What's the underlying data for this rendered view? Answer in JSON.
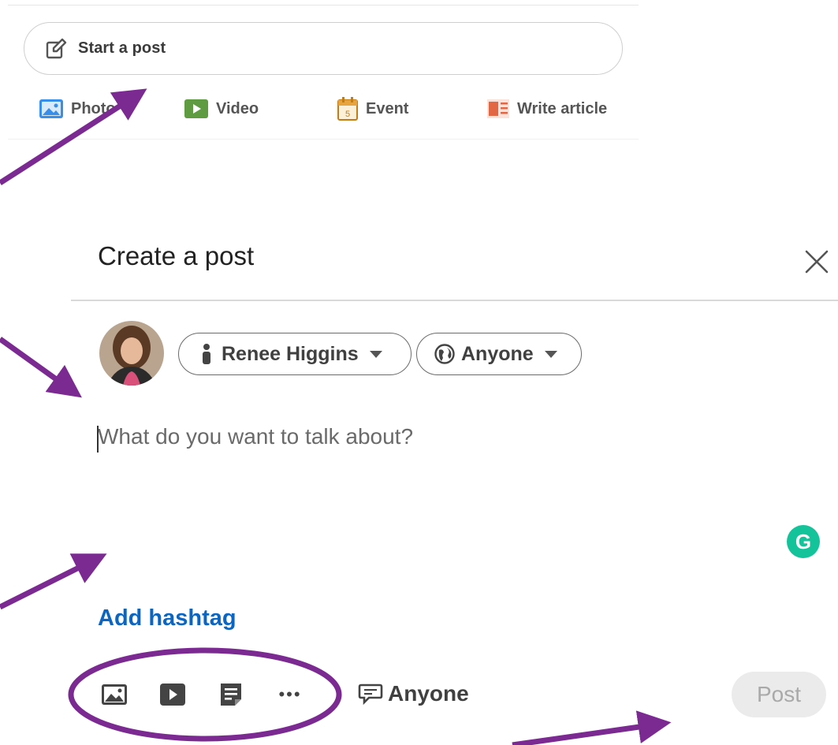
{
  "share_box": {
    "start_post_label": "Start a post",
    "start_post_icon": "pencil-edit-icon",
    "actions": [
      {
        "label": "Photo",
        "icon": "photo-icon",
        "color": "#378fe9"
      },
      {
        "label": "Video",
        "icon": "video-icon",
        "color": "#5f9b41"
      },
      {
        "label": "Event",
        "icon": "calendar-event-icon",
        "color": "#c37d16"
      },
      {
        "label": "Write article",
        "icon": "article-icon",
        "color": "#e16745"
      }
    ]
  },
  "dialog": {
    "title": "Create a post",
    "close_icon": "close-icon",
    "author_name": "Renee Higgins",
    "visibility": "Anyone",
    "composer_placeholder": "What do you want to talk about?",
    "grammarly_letter": "G",
    "add_hashtag": "Add hashtag",
    "toolbar_icons": [
      "image-icon",
      "video-play-icon",
      "document-icon",
      "more-icon"
    ],
    "more_label": "•••",
    "comment_visibility": "Anyone",
    "post_button": "Post"
  },
  "colors": {
    "link_blue": "#0a66c2",
    "annotation_purple": "#7b2a92",
    "grammarly_green": "#15c39a",
    "disabled_button_bg": "#ebebeb"
  }
}
